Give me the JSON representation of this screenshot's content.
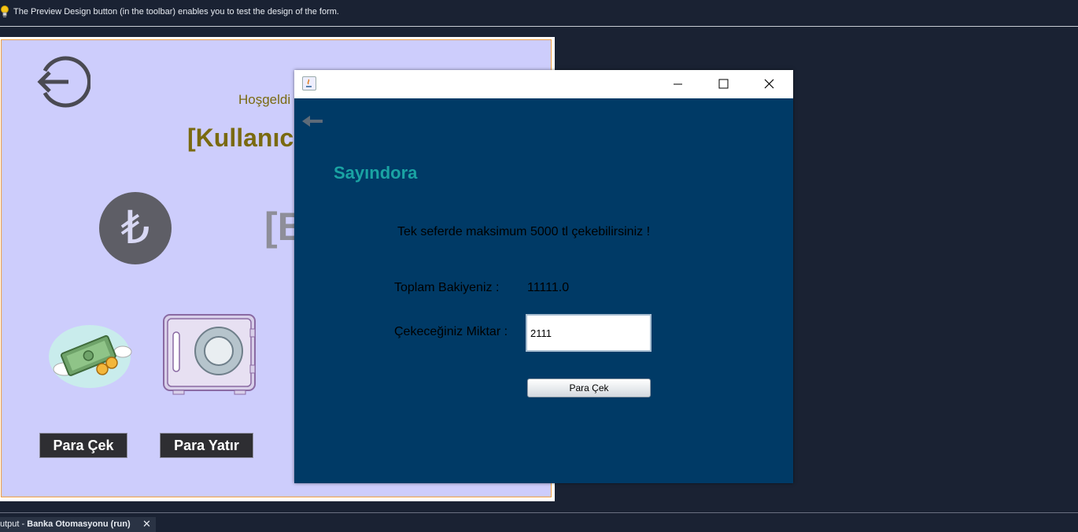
{
  "hint": {
    "text": "The Preview Design button (in the toolbar) enables you to test the design of the form.",
    "icon": "lightbulb-icon"
  },
  "designer": {
    "welcome": "Hoşgeldi",
    "username": "[Kullanıc",
    "balance_placeholder": "[B",
    "lira_symbol": "₺",
    "buttons": {
      "withdraw": "Para Çek",
      "deposit": "Para Yatır"
    }
  },
  "dialog": {
    "brand": "Sayındora",
    "limit_message": "Tek seferde maksimum 5000 tl çekebilirsiniz !",
    "balance_label": "Toplam Bakiyeniz :",
    "balance_value": "11111.0",
    "amount_label": "Çekeceğiniz Miktar :",
    "amount_value": "2111",
    "submit_label": "Para Çek"
  },
  "output_tab": {
    "prefix": "utput - ",
    "project": "Banka Otomasyonu (run)"
  },
  "colors": {
    "form_bg": "#cdcdfc",
    "dialog_bg": "#003a66",
    "brand": "#1aa3a3",
    "welcome_text": "#7a6a10"
  }
}
